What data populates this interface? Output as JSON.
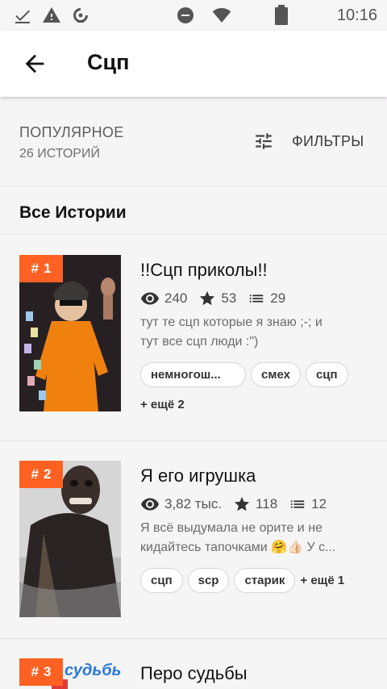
{
  "status_bar": {
    "time": "10:16",
    "icons": [
      "check-icon",
      "warning-icon",
      "data-saver-icon",
      "dnd-icon",
      "wifi-icon",
      "battery-icon"
    ]
  },
  "app_bar": {
    "title": "Сцп",
    "back_icon": "arrow-back-icon"
  },
  "sort": {
    "label": "ПОПУЛЯРНОЕ",
    "count": "26 ИСТОРИЙ",
    "filters_label": "ФИЛЬТРЫ",
    "filters_icon": "tune-icon"
  },
  "section": {
    "title": "Все Истории"
  },
  "stories": [
    {
      "rank": "1",
      "title": "!!Сцп приколы!!",
      "reads": "240",
      "votes": "53",
      "parts": "29",
      "desc_line1": "тут те сцп которые я знаю ;-; и",
      "desc_line2": "тут все сцп люди :\")",
      "tags": [
        "немногош...",
        "смех",
        "сцп"
      ],
      "more": "+ ещё 2"
    },
    {
      "rank": "2",
      "title": "Я его игрушка",
      "reads": "3,82 тыс.",
      "votes": "118",
      "parts": "12",
      "desc_line1": "Я всё выдумала не орите и не",
      "desc_line2": "кидайтесь тапочками 🤗👍🏻 У с...",
      "tags": [
        "сцп",
        "scp",
        "старик"
      ],
      "more": "+ ещё 1"
    },
    {
      "rank": "3",
      "title": "Перо судьбы",
      "cover_text": "судьбы"
    }
  ],
  "colors": {
    "accent": "#ff6122",
    "background": "#f6f5f6",
    "divider": "#e2e2e2"
  }
}
